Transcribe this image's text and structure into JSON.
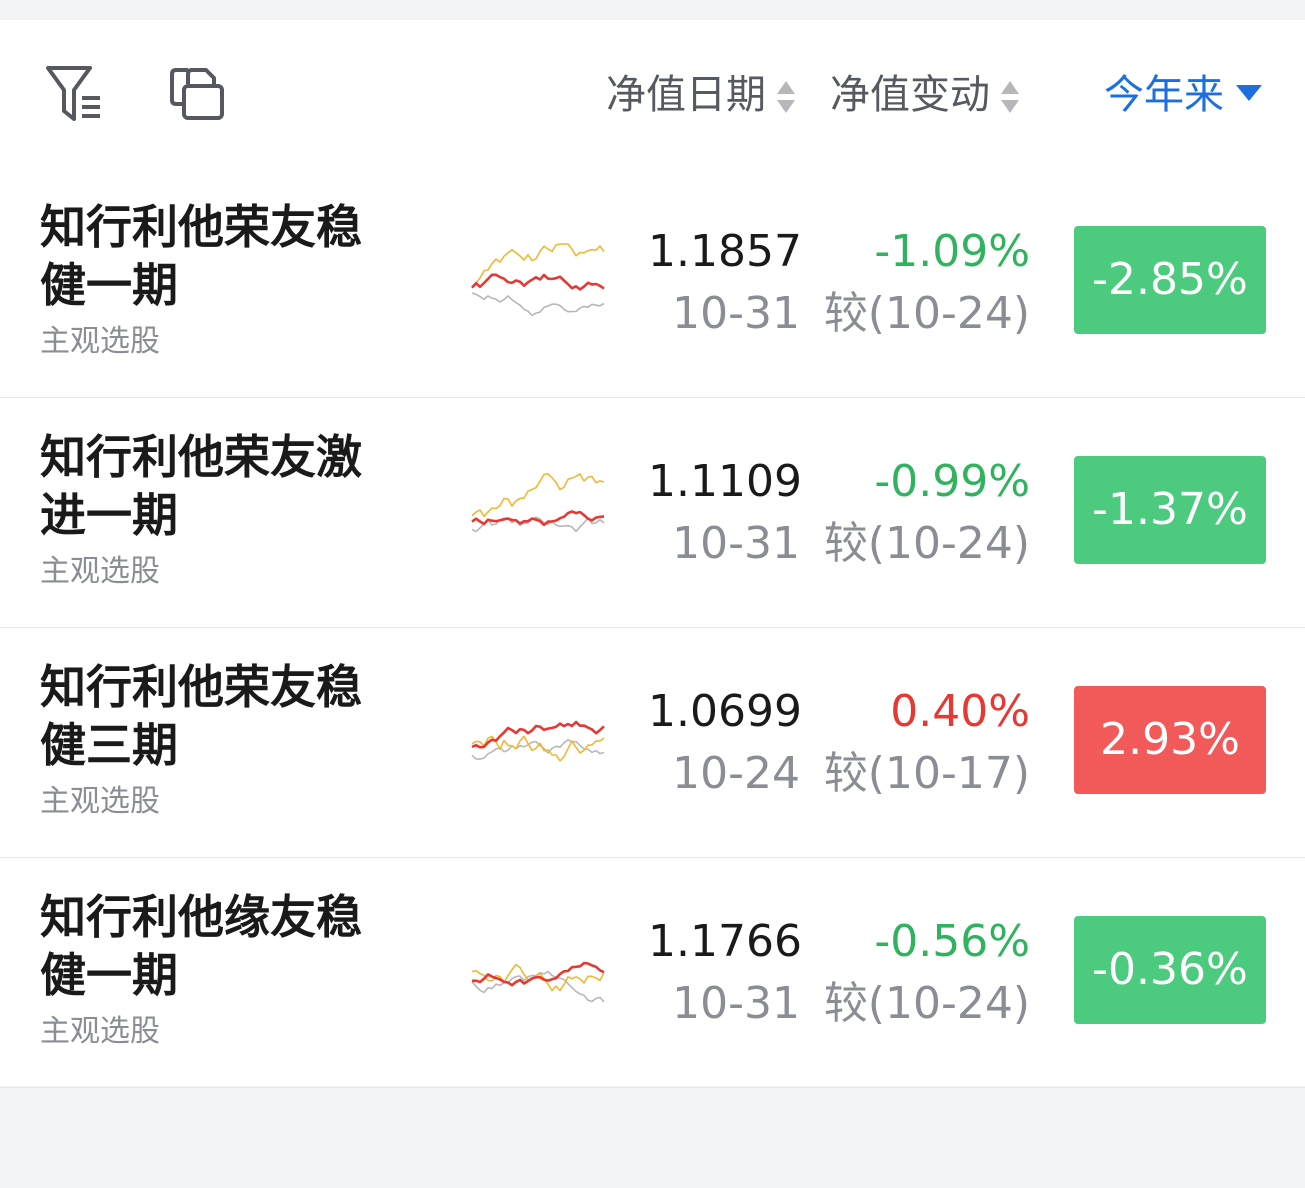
{
  "colors": {
    "green": "#4ccb7e",
    "red": "#f25a5a",
    "text_green": "#2fb35e",
    "text_red": "#e53935",
    "accent_blue": "#1d6fe0",
    "spark_gold": "#f2b731",
    "spark_red": "#e53935",
    "spark_gray": "#b5b7ba"
  },
  "toolbar": {
    "filter_icon": "filter-list-icon",
    "compare_icon": "compare-copy-icon",
    "col_nav_date": "净值日期",
    "col_nav_change": "净值变动",
    "period": "今年来"
  },
  "funds": [
    {
      "name": "知行利他荣友稳健一期",
      "type": "主观选股",
      "nav": "1.1857",
      "nav_date": "10-31",
      "change": "-1.09%",
      "change_direction": "down",
      "ref": "较(10-24)",
      "period_return": "-2.85%",
      "return_direction": "down"
    },
    {
      "name": "知行利他荣友激进一期",
      "type": "主观选股",
      "nav": "1.1109",
      "nav_date": "10-31",
      "change": "-0.99%",
      "change_direction": "down",
      "ref": "较(10-24)",
      "period_return": "-1.37%",
      "return_direction": "down"
    },
    {
      "name": "知行利他荣友稳健三期",
      "type": "主观选股",
      "nav": "1.0699",
      "nav_date": "10-24",
      "change": "0.40%",
      "change_direction": "up",
      "ref": "较(10-17)",
      "period_return": "2.93%",
      "return_direction": "up"
    },
    {
      "name": "知行利他缘友稳健一期",
      "type": "主观选股",
      "nav": "1.1766",
      "nav_date": "10-31",
      "change": "-0.56%",
      "change_direction": "down",
      "ref": "较(10-24)",
      "period_return": "-0.36%",
      "return_direction": "down"
    }
  ]
}
